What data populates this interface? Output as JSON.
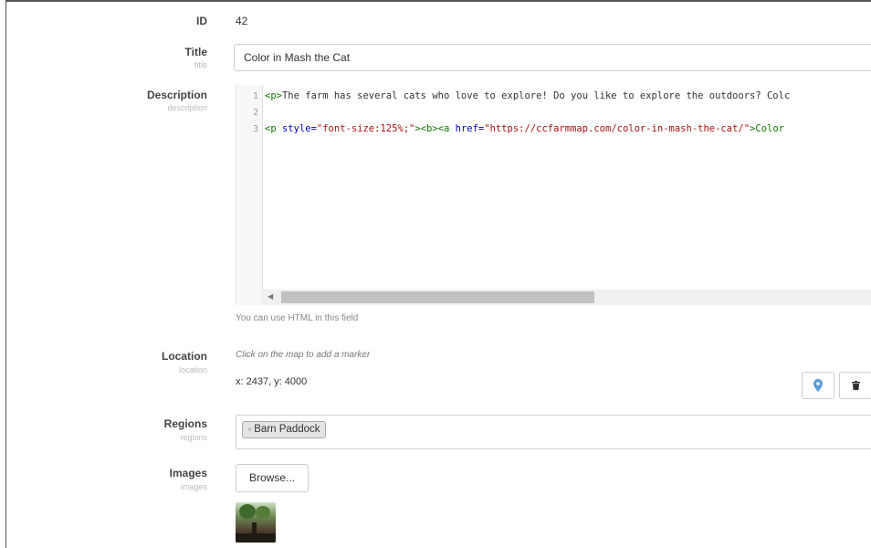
{
  "fields": {
    "id": {
      "label": "ID",
      "value": "42"
    },
    "title": {
      "label": "Title",
      "sublabel": "title",
      "value": "Color in Mash the Cat"
    },
    "description": {
      "label": "Description",
      "sublabel": "description",
      "line_numbers": [
        "1",
        "2",
        "3"
      ],
      "help": "You can use HTML in this field"
    },
    "location": {
      "label": "Location",
      "sublabel": "location",
      "hint": "Click on the map to add a marker",
      "coords": "x: 2437, y: 4000"
    },
    "regions": {
      "label": "Regions",
      "sublabel": "regions",
      "tags": [
        "Barn Paddock"
      ],
      "remove_symbol": "×"
    },
    "images": {
      "label": "Images",
      "sublabel": "images",
      "browse_label": "Browse..."
    }
  },
  "code_lines": {
    "line1": {
      "open": "<p>",
      "text": "The farm has several cats who love to explore! Do you like to explore the outdoors? Colc"
    },
    "line3": {
      "p_open": "<p ",
      "style_attr": "style=",
      "style_val": "\"font-size:125%;\"",
      "bold_a": "><b><a ",
      "href_attr": "href=",
      "href_val": "\"https://ccfarmmap.com/color-in-mash-the-cat/\"",
      "close": ">Color"
    }
  },
  "icons": {
    "marker": "map-marker-icon",
    "trash": "trash-icon"
  },
  "colors": {
    "marker_blue": "#5b9bd5",
    "tag_green": "#117700",
    "attr_blue": "#0000cc",
    "string_red": "#aa1111"
  }
}
